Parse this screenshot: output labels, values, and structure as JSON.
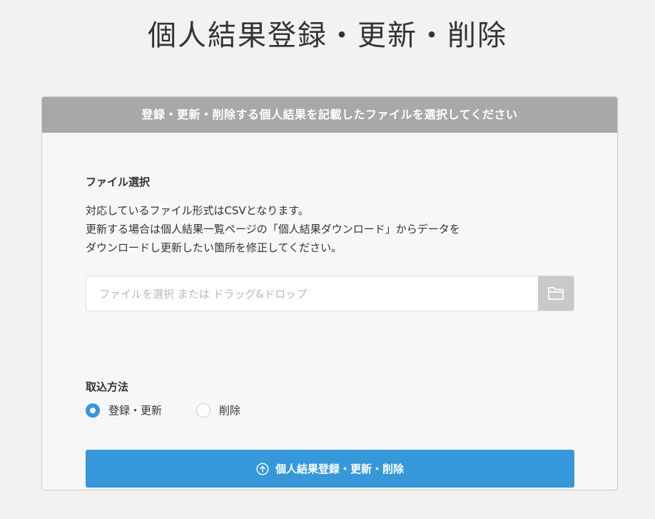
{
  "page": {
    "title": "個人結果登録・更新・削除"
  },
  "card": {
    "header": "登録・更新・削除する個人結果を記載したファイルを選択してください",
    "file_section": {
      "label": "ファイル選択",
      "description_lines": [
        "対応しているファイル形式はCSVとなります。",
        "更新する場合は個人結果一覧ページの「個人結果ダウンロード」からデータを",
        "ダウンロードし更新したい箇所を修正してください。"
      ],
      "placeholder": "ファイルを選択 または ドラッグ&ドロップ",
      "folder_icon": "folder-icon"
    },
    "method_section": {
      "label": "取込方法",
      "options": [
        {
          "label": "登録・更新",
          "checked": true
        },
        {
          "label": "削除",
          "checked": false
        }
      ]
    },
    "submit": {
      "label": "個人結果登録・更新・削除",
      "icon": "upload-circle-icon"
    }
  },
  "colors": {
    "accent": "#3498db",
    "header_bg": "#a8a8a8",
    "page_bg": "#f2f2f2"
  }
}
